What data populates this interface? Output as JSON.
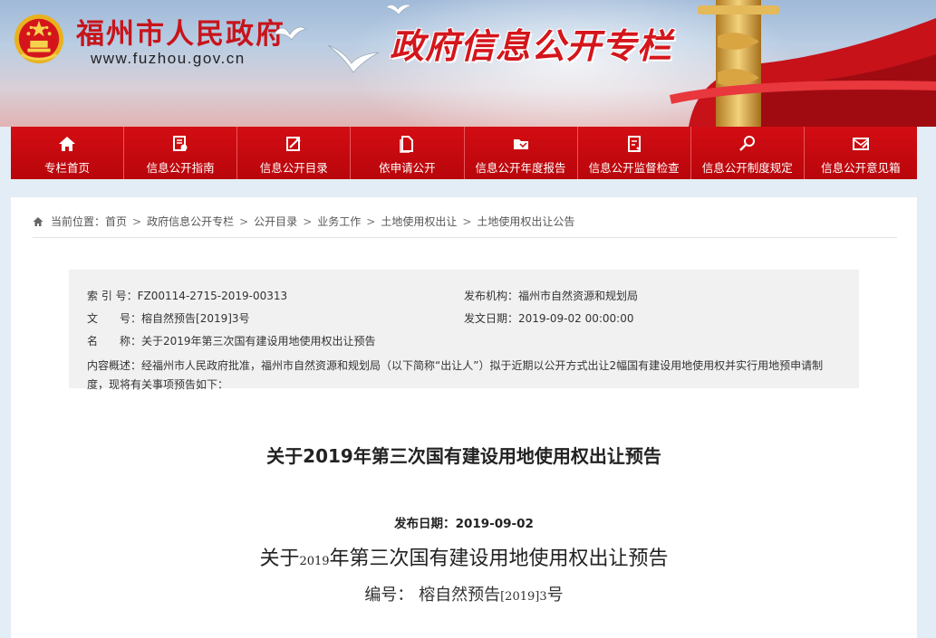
{
  "header": {
    "site_name": "福州市人民政府",
    "site_url": "www.fuzhou.gov.cn",
    "column_title": "政府信息公开专栏"
  },
  "nav": {
    "items": [
      {
        "label": "专栏首页",
        "icon": "home-icon"
      },
      {
        "label": "信息公开指南",
        "icon": "guide-icon"
      },
      {
        "label": "信息公开目录",
        "icon": "catalog-icon"
      },
      {
        "label": "依申请公开",
        "icon": "request-icon"
      },
      {
        "label": "信息公开年度报告",
        "icon": "annual-report-icon"
      },
      {
        "label": "信息公开监督检查",
        "icon": "inspection-icon"
      },
      {
        "label": "信息公开制度规定",
        "icon": "regulation-icon"
      },
      {
        "label": "信息公开意见箱",
        "icon": "feedback-icon"
      }
    ],
    "color": "#c2070d"
  },
  "breadcrumb": {
    "prefix": "当前位置：",
    "items": [
      "首页",
      "政府信息公开专栏",
      "公开目录",
      "业务工作",
      "土地使用权出让",
      "土地使用权出让公告"
    ],
    "separator": ">"
  },
  "meta": {
    "index_label": "索 引 号：",
    "index_value": "FZ00114-2715-2019-00313",
    "publisher_label": "发布机构：",
    "publisher_value": "福州市自然资源和规划局",
    "doc_no_label": "文　　号：",
    "doc_no_value": "榕自然预告[2019]3号",
    "issue_date_label": "发文日期：",
    "issue_date_value": "2019-09-02 00:00:00",
    "name_label": "名　　称：",
    "name_value": "关于2019年第三次国有建设用地使用权出让预告",
    "summary_label": "内容概述：",
    "summary_value": "经福州市人民政府批准，福州市自然资源和规划局（以下简称“出让人”）拟于近期以公开方式出让2幅国有建设用地使用权并实行用地预申请制度，现将有关事项预告如下："
  },
  "article": {
    "title": "关于2019年第三次国有建设用地使用权出让预告",
    "pub_date_label": "发布日期：",
    "pub_date_value": "2019-09-02",
    "body_title_pre": "关于",
    "body_title_year": "2019",
    "body_title_post": "年第三次国有建设用地使用权出让预告",
    "number_label": "编号：",
    "number_value_pre": "榕自然预告",
    "number_value_bracket": "[2019]3",
    "number_value_post": "号"
  }
}
